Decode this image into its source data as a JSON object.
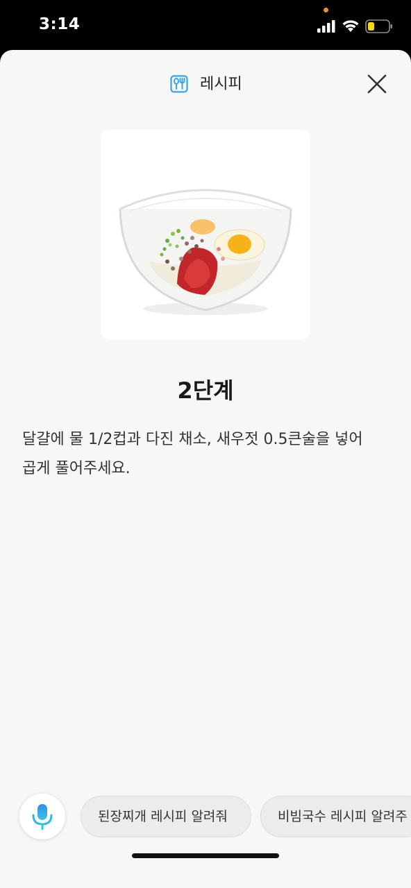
{
  "status_bar": {
    "time": "3:14",
    "signal_icon": "cellular-signal-icon",
    "wifi_icon": "wifi-icon",
    "battery_icon": "battery-low-icon",
    "battery_color": "#f5d41a",
    "privacy_dot_color": "#e8912d"
  },
  "header": {
    "icon": "recipe-icon",
    "title": "레시피",
    "close_icon": "close-icon"
  },
  "step": {
    "image_alt": "glass bowl with raw eggs, chopped vegetables, red pepper flakes and salted shrimp",
    "title": "2단계",
    "description": "달걀에 물 1/2컵과 다진 채소, 새우젓 0.5큰술을 넣어 곱게 풀어주세요."
  },
  "bottom": {
    "mic_icon": "microphone-icon",
    "suggestions": [
      "된장찌개 레시피 알려줘",
      "비빔국수 레시피 알려주"
    ]
  },
  "colors": {
    "accent": "#3aa4df",
    "sheet_background": "#f7f7f7",
    "text_primary": "#1a1a1a"
  }
}
